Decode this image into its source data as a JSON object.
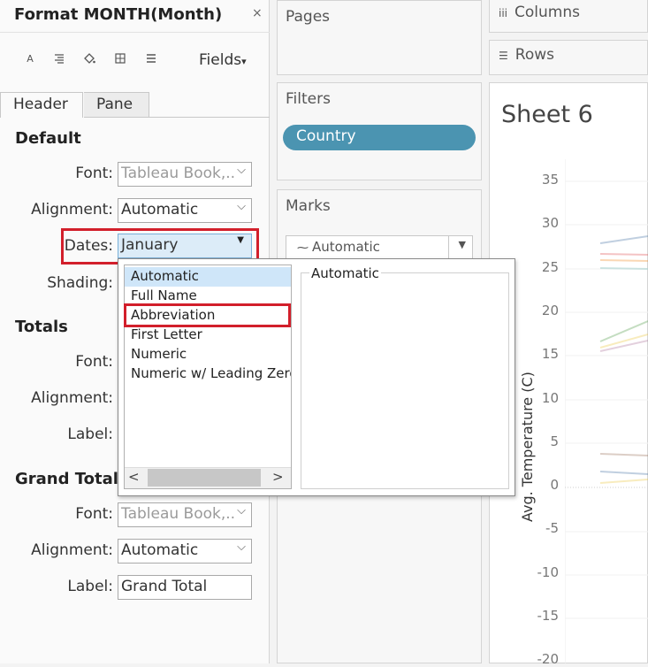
{
  "format_pane": {
    "title": "Format MONTH(Month)",
    "close_glyph": "×",
    "toolbar": {
      "icons": [
        "font-icon",
        "alignment-icon",
        "shading-icon",
        "borders-icon",
        "lines-icon"
      ],
      "fields_label": "Fields",
      "fields_caret": "▾"
    },
    "tabs": [
      {
        "label": "Header"
      },
      {
        "label": "Pane"
      }
    ],
    "default": {
      "title": "Default",
      "font_label": "Font:",
      "font_value": "Tableau Book,..",
      "alignment_label": "Alignment:",
      "alignment_value": "Automatic",
      "dates_label": "Dates:",
      "dates_value": "January",
      "shading_label": "Shading:"
    },
    "totals": {
      "title": "Totals",
      "font_label": "Font:",
      "alignment_label": "Alignment:",
      "label_label": "Label:"
    },
    "grand_totals": {
      "title": "Grand Totals",
      "font_label": "Font:",
      "font_value": "Tableau Book,..",
      "alignment_label": "Alignment:",
      "alignment_value": "Automatic",
      "label_label": "Label:",
      "label_value": "Grand Total"
    }
  },
  "dates_dropdown": {
    "options": [
      {
        "label": "Automatic",
        "selected": true
      },
      {
        "label": "Full Name",
        "selected": false
      },
      {
        "label": "Abbreviation",
        "selected": false,
        "highlighted": true
      },
      {
        "label": "First Letter",
        "selected": false
      },
      {
        "label": "Numeric",
        "selected": false
      },
      {
        "label": "Numeric w/ Leading Zeros",
        "selected": false
      }
    ],
    "preview_label": "Automatic",
    "scroll_left": "<",
    "scroll_right": ">"
  },
  "cards": {
    "pages_title": "Pages",
    "filters_title": "Filters",
    "filter_pill": "Country",
    "marks_title": "Marks",
    "marks_type": "Automatic"
  },
  "shelves": {
    "columns_label": "Columns",
    "rows_label": "Rows"
  },
  "sheet": {
    "title": "Sheet 6",
    "y_axis_label": "Avg. Temperature (C)",
    "y_ticks": [
      "35",
      "30",
      "25",
      "20",
      "15",
      "10",
      "5",
      "0",
      "-5",
      "-10",
      "-15",
      "-20"
    ]
  },
  "colors": {
    "pill": "#4b94b1",
    "highlight_box": "#d21f2b",
    "selected_option": "#cfe6f9"
  }
}
